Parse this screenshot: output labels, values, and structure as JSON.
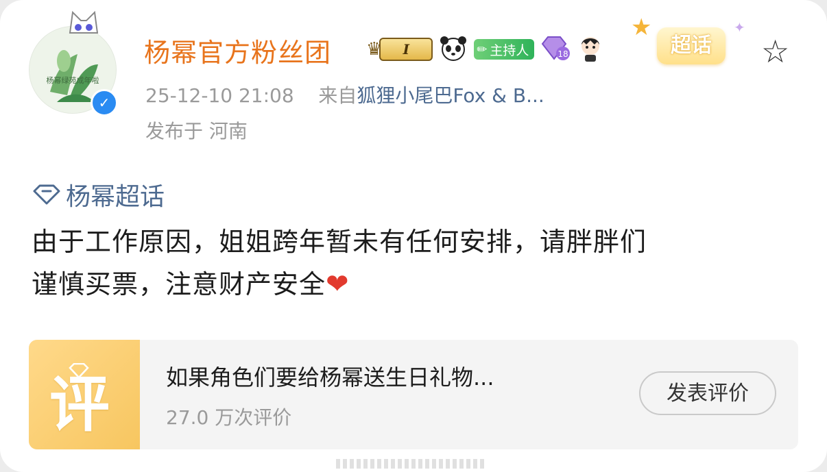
{
  "post": {
    "author": "杨幂官方粉丝团",
    "verified_icon": "verified-check-icon",
    "badges": {
      "level": "I",
      "host": "主持人",
      "member_level": "18",
      "super_topic_tag": "超话"
    },
    "timestamp": "25-12-10 21:08",
    "source_prefix": "来自",
    "source": "狐狸小尾巴Fox & B...",
    "location": "发布于 河南",
    "topic": "杨幂超话",
    "text_line1": "由于工作原因，姐姐跨年暂未有任何安排，请胖胖们",
    "text_line2": "谨慎买票，注意财产安全",
    "emoji": "❤"
  },
  "review_card": {
    "icon_char": "评",
    "title": "如果角色们要给杨幂送生日礼物...",
    "count": "27.0 万次评价",
    "button_label": "发表评价"
  },
  "colors": {
    "author": "#e8741c",
    "link": "#4d6a90",
    "meta": "#9a9a9a",
    "verified": "#2a8bf2",
    "review_icon_bg": "#f7c660"
  }
}
